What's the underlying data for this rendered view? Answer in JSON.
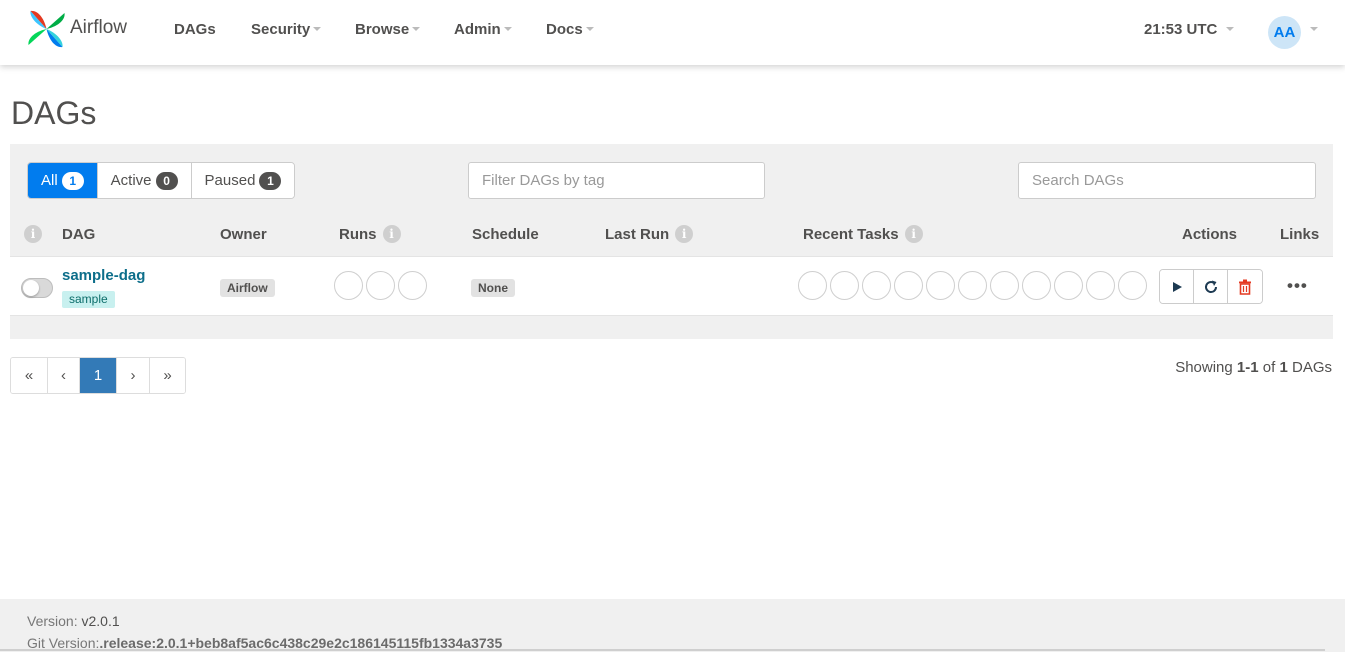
{
  "navbar": {
    "brand": "Airflow",
    "items": [
      {
        "label": "DAGs",
        "dropdown": false
      },
      {
        "label": "Security",
        "dropdown": true
      },
      {
        "label": "Browse",
        "dropdown": true
      },
      {
        "label": "Admin",
        "dropdown": true
      },
      {
        "label": "Docs",
        "dropdown": true
      }
    ],
    "time": "21:53 UTC",
    "user_initials": "AA"
  },
  "page_title": "DAGs",
  "filters": {
    "tabs": [
      {
        "label": "All",
        "count": "1",
        "active": true
      },
      {
        "label": "Active",
        "count": "0",
        "active": false
      },
      {
        "label": "Paused",
        "count": "1",
        "active": false
      }
    ],
    "tag_placeholder": "Filter DAGs by tag",
    "search_placeholder": "Search DAGs"
  },
  "table": {
    "headers": {
      "dag": "DAG",
      "owner": "Owner",
      "runs": "Runs",
      "schedule": "Schedule",
      "last_run": "Last Run",
      "recent_tasks": "Recent Tasks",
      "actions": "Actions",
      "links": "Links"
    },
    "rows": [
      {
        "dag_id": "sample-dag",
        "tag": "sample",
        "owner": "Airflow",
        "schedule": "None",
        "last_run": "",
        "paused": true
      }
    ],
    "info_glyph": "i",
    "more_glyph": "•••"
  },
  "pagination": {
    "first": "«",
    "prev": "‹",
    "current": "1",
    "next": "›",
    "last": "»"
  },
  "summary": {
    "prefix": "Showing ",
    "range": "1-1",
    "of": " of ",
    "total": "1",
    "suffix": " DAGs"
  },
  "footer": {
    "version_label": "Version: ",
    "version": "v2.0.1",
    "git_label": "Git Version:",
    "git_version": ".release:2.0.1+beb8af5ac6c438c29e2c186145115fb1334a3735"
  },
  "colors": {
    "accent": "#017cee",
    "page_active": "#337ab7",
    "delete": "#e43921",
    "tag_bg": "#c8f0ef"
  }
}
